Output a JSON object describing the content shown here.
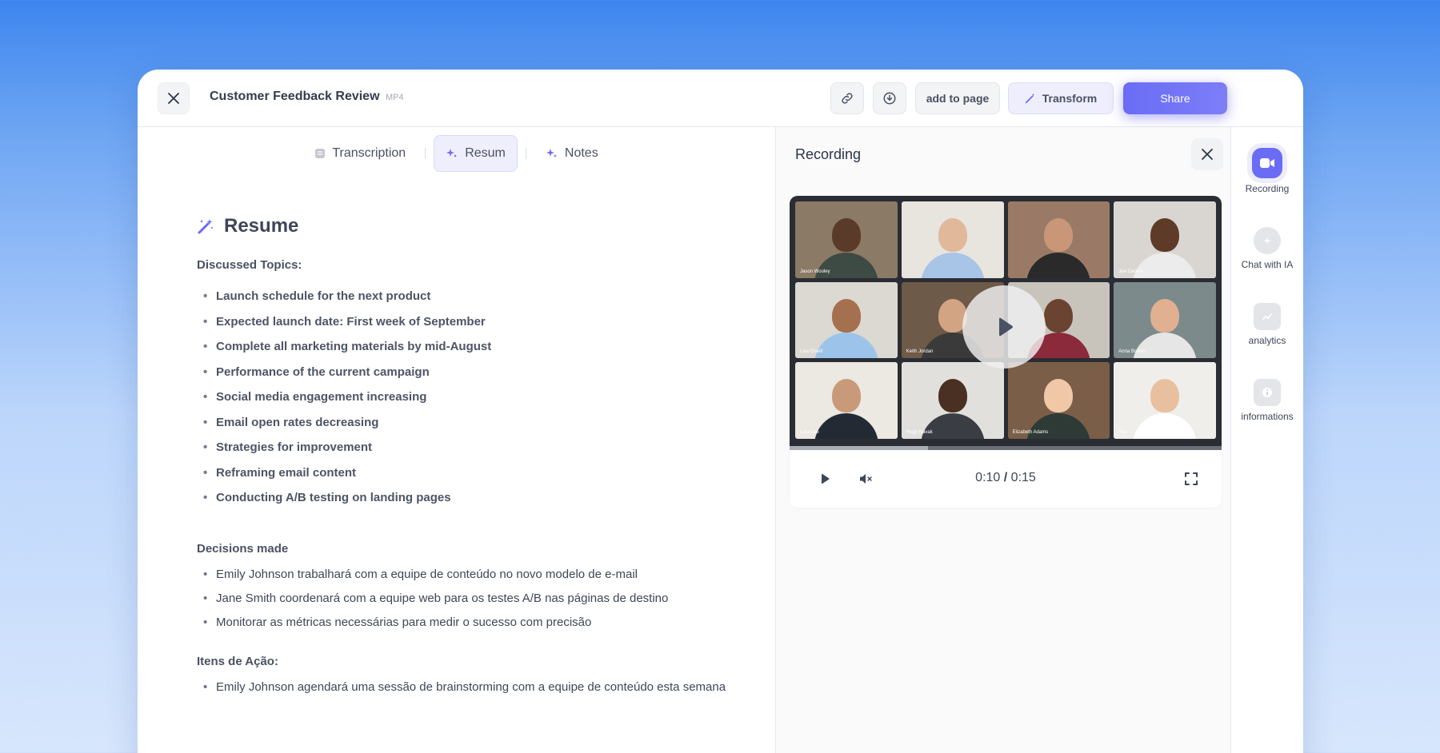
{
  "header": {
    "title": "Customer Feedback Review",
    "file_type": "MP4",
    "add_to_page_label": "add to page",
    "transform_label": "Transform",
    "share_label": "Share"
  },
  "tabs": [
    {
      "label": "Transcription",
      "active": false
    },
    {
      "label": "Resum",
      "active": true
    },
    {
      "label": "Notes",
      "active": false
    }
  ],
  "resume": {
    "title": "Resume",
    "discussed_title": "Discussed Topics:",
    "discussed": [
      "Launch schedule for the next product",
      "Expected launch date: First week of September",
      "Complete all marketing materials by mid-August",
      "Performance of the current campaign",
      "Social media engagement increasing",
      "Email open rates decreasing",
      "Strategies for improvement",
      "Reframing email content",
      "Conducting A/B testing on landing pages"
    ],
    "decisions_title": "Decisions made",
    "decisions": [
      "Emily Johnson trabalhará com a equipe de conteúdo no novo modelo de e-mail",
      "Jane Smith coordenará com a equipe web para os testes A/B nas páginas de destino",
      "Monitorar as métricas necessárias para medir o sucesso com precisão"
    ],
    "actions_title": "Itens de Ação:",
    "actions": [
      "Emily Johnson agendará uma sessão de brainstorming com a equipe de conteúdo esta semana"
    ]
  },
  "recording": {
    "title": "Recording",
    "time_current": "0:10",
    "time_sep": "/",
    "time_total": "0:15",
    "progress": 0.32,
    "participants": [
      {
        "name": "Jason Wooley",
        "bg": "#8a7a66",
        "skin": "#5a3a28",
        "shirt": "#3e4a44"
      },
      {
        "name": "",
        "bg": "#e8e4de",
        "skin": "#e2b89a",
        "shirt": "#a8c4e6"
      },
      {
        "name": "",
        "bg": "#9a7a66",
        "skin": "#c99678",
        "shirt": "#2a2a2a"
      },
      {
        "name": "Joe Carson",
        "bg": "#d9d6d2",
        "skin": "#5e3b28",
        "shirt": "#ececec"
      },
      {
        "name": "Lisa Oneill",
        "bg": "#dcd8d2",
        "skin": "#a4704e",
        "shirt": "#9cc4ea"
      },
      {
        "name": "Keith Jordan",
        "bg": "#6e5a48",
        "skin": "#d2a484",
        "shirt": "#3a3a3a"
      },
      {
        "name": "",
        "bg": "#c8c4bc",
        "skin": "#6a4430",
        "shirt": "#8a2a3a"
      },
      {
        "name": "Anna Brown",
        "bg": "#7c8a8c",
        "skin": "#e0b090",
        "shirt": "#e6e6e6"
      },
      {
        "name": "Lara Lee",
        "bg": "#ece8e2",
        "skin": "#c99a7a",
        "shirt": "#242a34"
      },
      {
        "name": "Hugo Navak",
        "bg": "#e2e0dc",
        "skin": "#4a3022",
        "shirt": "#3a3e44"
      },
      {
        "name": "Elizabeth Adams",
        "bg": "#7a5e48",
        "skin": "#f0c8a8",
        "shirt": "#2e3a36"
      },
      {
        "name": "You",
        "bg": "#f0eeea",
        "skin": "#e8c0a0",
        "shirt": "#ffffff"
      }
    ]
  },
  "rail": [
    {
      "label": "Recording",
      "active": true
    },
    {
      "label": "Chat with IA",
      "active": false
    },
    {
      "label": "analytics",
      "active": false
    },
    {
      "label": "informations",
      "active": false
    }
  ],
  "colors": {
    "accent": "#6a6cf5",
    "accent_soft": "#eeeefd"
  }
}
